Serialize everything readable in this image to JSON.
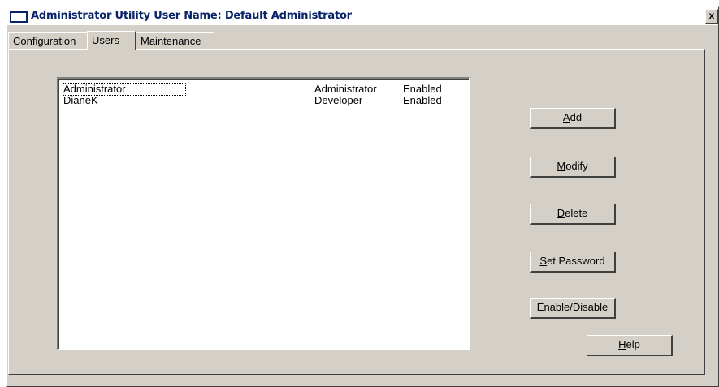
{
  "window": {
    "title": "Administrator Utility  User Name: Default Administrator",
    "close_label": "x"
  },
  "tabs": [
    {
      "label": "Configuration",
      "active": false
    },
    {
      "label": "Users",
      "active": true
    },
    {
      "label": "Maintenance",
      "active": false
    }
  ],
  "users": {
    "rows": [
      {
        "name": "Administrator",
        "role": "Administrator",
        "status": "Enabled"
      },
      {
        "name": "DianeK",
        "role": "Developer",
        "status": "Enabled"
      }
    ]
  },
  "buttons": {
    "add": {
      "mnemonic": "A",
      "rest": "dd"
    },
    "modify": {
      "mnemonic": "M",
      "rest": "odify"
    },
    "delete": {
      "mnemonic": "D",
      "rest": "elete"
    },
    "set_password": {
      "mnemonic": "S",
      "rest": "et Password"
    },
    "enable_disable": {
      "mnemonic": "E",
      "rest": "nable/Disable"
    },
    "help": {
      "mnemonic": "H",
      "rest": "elp"
    }
  },
  "colors": {
    "title_text": "#0a246a",
    "face": "#d4d0c8"
  }
}
